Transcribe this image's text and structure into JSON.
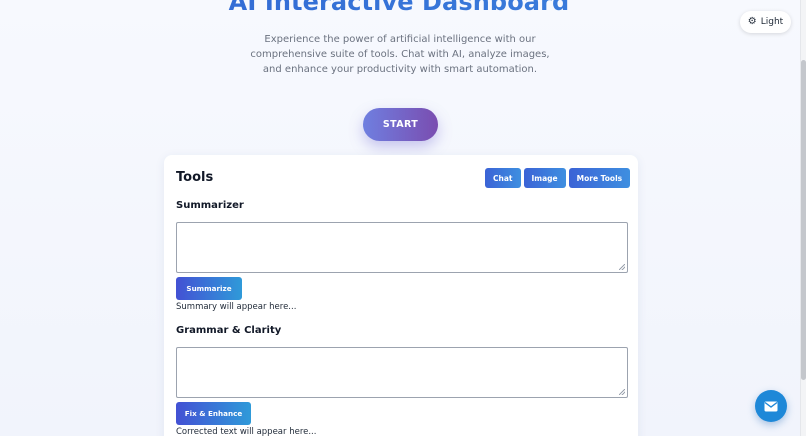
{
  "hero": {
    "title": "AI Interactive Dashboard",
    "description": "Experience the power of artificial intelligence with our comprehensive suite of tools. Chat with AI, analyze images, and enhance your productivity with smart automation.",
    "start_label": "START"
  },
  "theme_toggle": {
    "icon": "gear-icon",
    "label": "Light"
  },
  "tools": {
    "title": "Tools",
    "tabs": [
      {
        "label": "Chat"
      },
      {
        "label": "Image"
      },
      {
        "label": "More Tools"
      }
    ],
    "summarizer": {
      "heading": "Summarizer",
      "input_value": "",
      "button_label": "Summarize",
      "result": "Summary will appear here..."
    },
    "grammar": {
      "heading": "Grammar & Clarity",
      "input_value": "",
      "button_label": "Fix & Enhance",
      "result": "Corrected text will appear here..."
    }
  },
  "contact_fab": {
    "icon": "mail-icon"
  },
  "colors": {
    "accent_blue": "#3b6fd6",
    "start_gradient_start": "#6f7fe0",
    "start_gradient_end": "#7a4db0",
    "fab": "#1e88d8"
  }
}
